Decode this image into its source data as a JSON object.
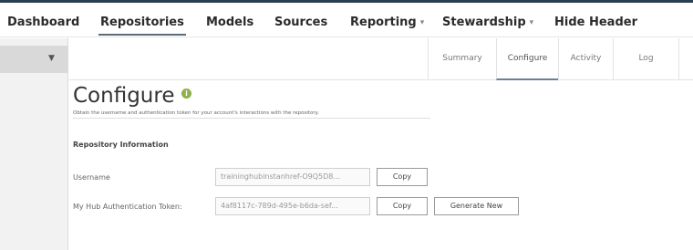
{
  "nav": {
    "items": [
      {
        "label": "Dashboard",
        "dropdown": false
      },
      {
        "label": "Repositories",
        "dropdown": false,
        "active": true
      },
      {
        "label": "Models",
        "dropdown": false
      },
      {
        "label": "Sources",
        "dropdown": false
      },
      {
        "label": "Reporting",
        "dropdown": true
      },
      {
        "label": "Stewardship",
        "dropdown": true
      },
      {
        "label": "Hide Header",
        "dropdown": false
      }
    ]
  },
  "subtabs": [
    "Summary",
    "Configure",
    "Activity",
    "Log"
  ],
  "page": {
    "title": "Configure",
    "subtitle": "Obtain the username and authentication token for your account's interactions with the repository."
  },
  "repo_info": {
    "section_title": "Repository Information",
    "username_label": "Username",
    "username_value": "traininghubinstanhref-O9Q5D8...",
    "token_label": "My Hub Authentication Token:",
    "token_value": "4af8117c-789d-495e-b6da-sef...",
    "copy_label": "Copy",
    "generate_label": "Generate New"
  },
  "icons": {
    "info": "info-icon",
    "sidebar_toggle": "chevron-down-icon",
    "dropdown": "caret-down-icon"
  },
  "colors": {
    "nav_bar_top": "#2b3d52",
    "info_icon": "#8cb04a",
    "active_tab_underline": "#6b8199"
  }
}
